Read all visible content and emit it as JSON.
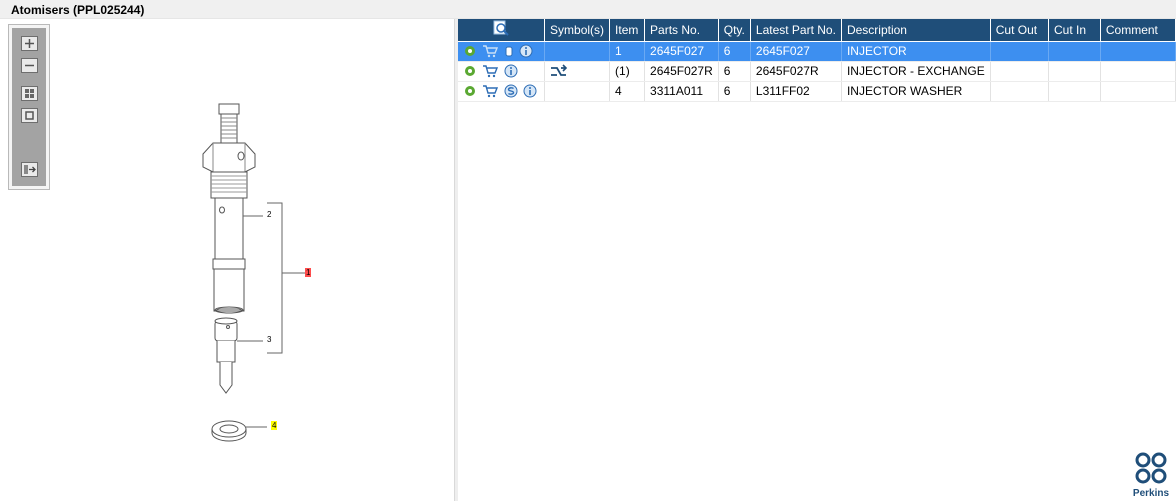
{
  "window": {
    "title": "Atomisers (PPL025244)"
  },
  "toolbox": {
    "buttons": [
      "zoom-in-icon",
      "zoom-out-icon",
      "fit-all-icon",
      "fit-window-icon",
      "export-icon"
    ]
  },
  "diagram": {
    "callouts": [
      "2",
      "1",
      "3",
      "4"
    ],
    "callout_colors": {
      "1": "#ff4d4d",
      "4": "#ffff00"
    }
  },
  "grid": {
    "headers": [
      "Symbol(s)",
      "Item",
      "Parts No.",
      "Qty.",
      "Latest Part No.",
      "Description",
      "Cut Out",
      "Cut In",
      "Comment"
    ],
    "header_icon": "magnify-preview-icon",
    "rows": [
      {
        "selected": true,
        "icons": [
          "gear-icon",
          "cart-icon",
          "hand-icon",
          "info-icon"
        ],
        "symbol": "",
        "item": "1",
        "part_no": "2645F027",
        "qty": "6",
        "latest_part_no": "2645F027",
        "description": "INJECTOR",
        "cut_out": "",
        "cut_in": "",
        "comment": ""
      },
      {
        "selected": false,
        "icons": [
          "gear-icon",
          "cart-icon",
          "info-icon"
        ],
        "symbol": "exchange-symbol-icon",
        "item": "(1)",
        "part_no": "2645F027R",
        "qty": "6",
        "latest_part_no": "2645F027R",
        "description": "INJECTOR - EXCHANGE",
        "cut_out": "",
        "cut_in": "",
        "comment": ""
      },
      {
        "selected": false,
        "icons": [
          "gear-icon",
          "cart-icon",
          "s-icon",
          "info-icon"
        ],
        "symbol": "",
        "item": "4",
        "part_no": "3311A011",
        "qty": "6",
        "latest_part_no": "L311FF02",
        "description": "INJECTOR WASHER",
        "cut_out": "",
        "cut_in": "",
        "comment": ""
      }
    ]
  },
  "brand": {
    "name": "Perkins",
    "color": "#1f4e79"
  },
  "colors": {
    "header_bg": "#1f4e79",
    "selected_row": "#3d8ff0"
  }
}
